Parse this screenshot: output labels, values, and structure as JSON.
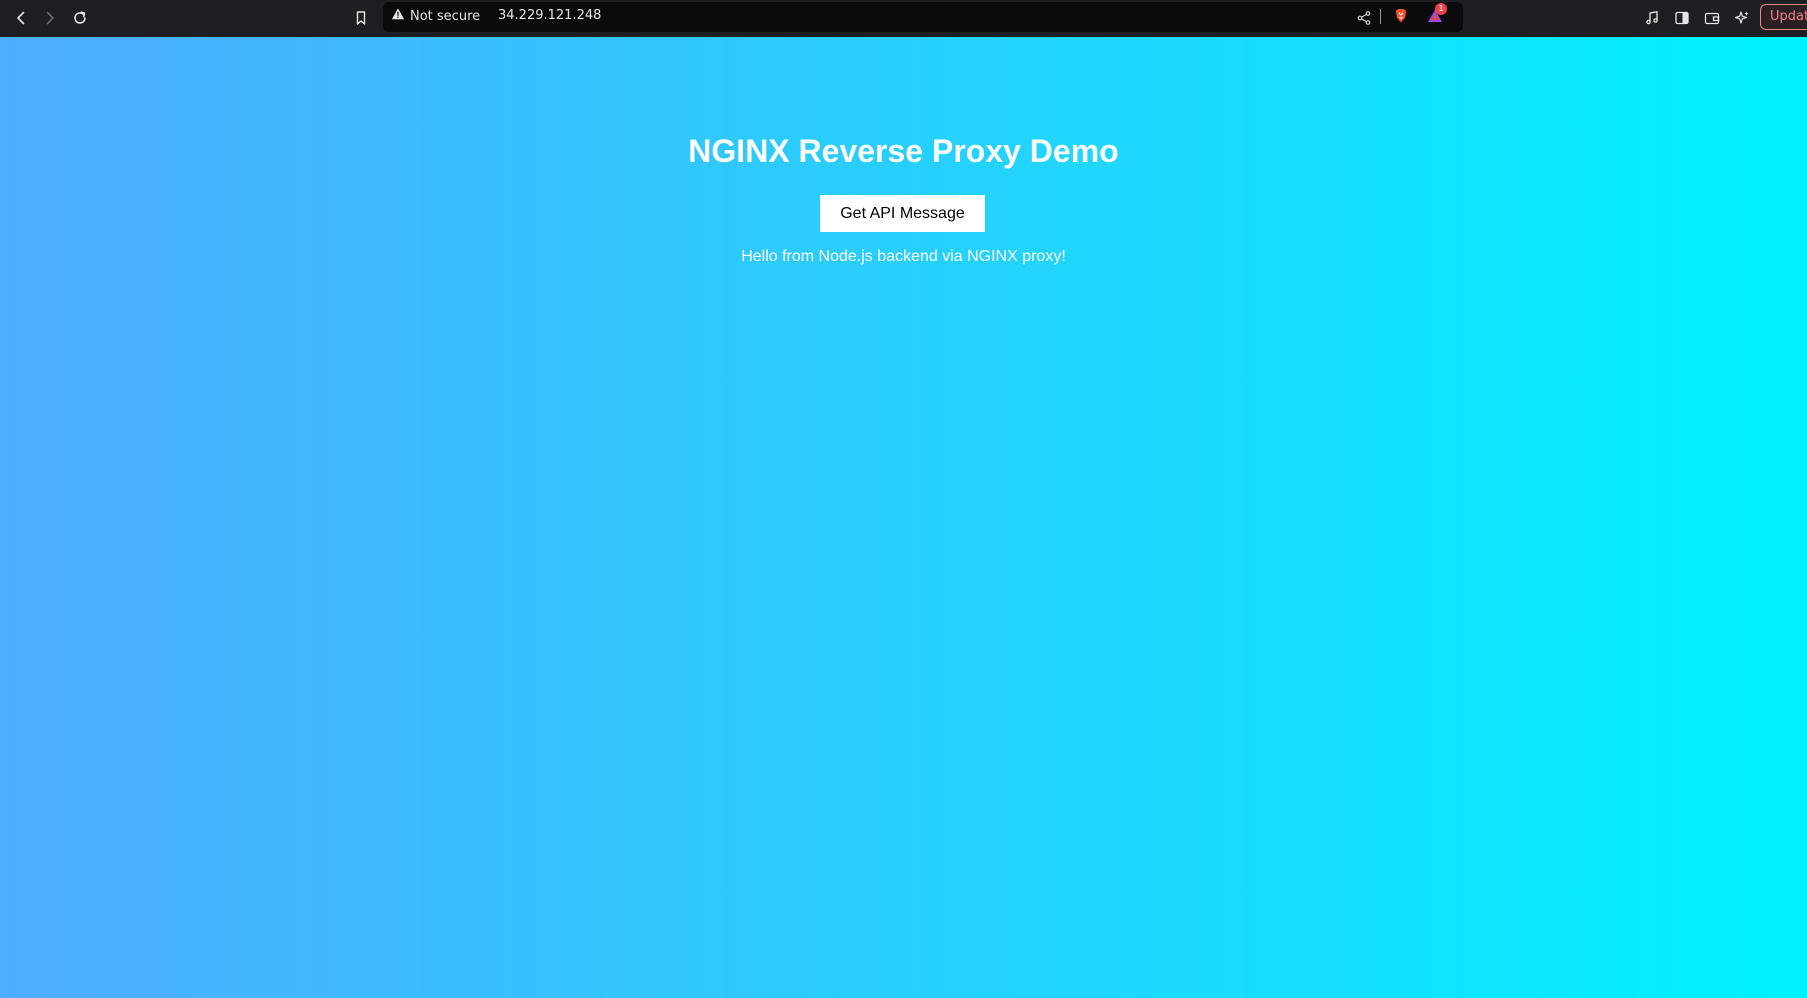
{
  "browser": {
    "security_label": "Not secure",
    "url": "34.229.121.248",
    "rewards_badge": "1",
    "update_label": "Updat"
  },
  "icons": {
    "back": "back-arrow-icon",
    "forward": "forward-arrow-icon",
    "reload": "reload-icon",
    "bookmark": "bookmark-icon",
    "warning": "warning-icon",
    "share": "share-icon",
    "brave": "brave-shield-icon",
    "rewards": "brave-rewards-icon",
    "music": "music-note-icon",
    "sidebar": "sidebar-icon",
    "wallet": "wallet-icon",
    "leo": "leo-ai-icon"
  },
  "page": {
    "title": "NGINX Reverse Proxy Demo",
    "button_label": "Get API Message",
    "message": "Hello from Node.js backend via NGINX proxy!"
  },
  "colors": {
    "gradient_start": "#4facfe",
    "gradient_end": "#00f2fe",
    "toolbar": "#1e1f22",
    "text": "#ffffff"
  }
}
